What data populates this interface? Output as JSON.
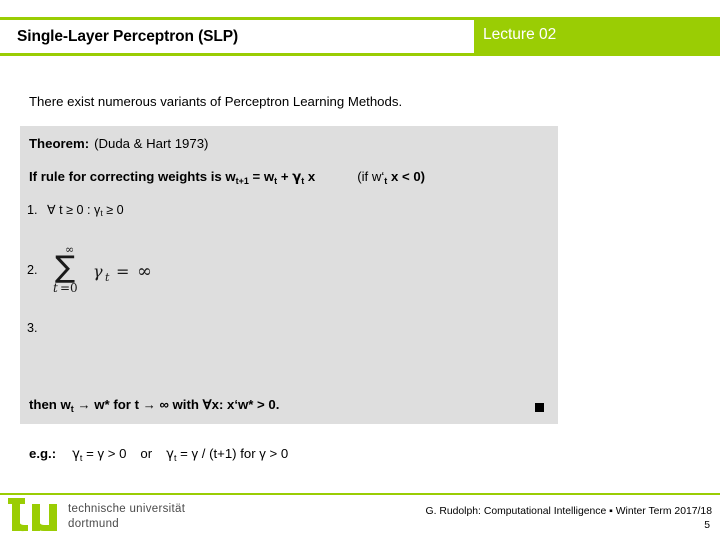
{
  "slide": {
    "header": {
      "title": "Single-Layer Perceptron (SLP)",
      "lecture": "Lecture 02",
      "accent_color": "#9ACD04",
      "plate_color": "#FFFFFF"
    },
    "intro": "There exist numerous variants of Perceptron Learning Methods.",
    "theorem": {
      "background_color": "#DEDEDE",
      "label": "Theorem:",
      "citation": "(Duda & Hart 1973)",
      "rule_text": "If rule for correcting weights is w",
      "rule_sub_1": "t+1",
      "rule_eq": " = w",
      "rule_sub_2": "t",
      "rule_plus": " + ",
      "rule_gamma": "γ",
      "rule_sub_3": "t",
      "rule_x": " x",
      "rule_condition": "(if w‘",
      "rule_condition_sub": "t",
      "rule_condition_tail": " x < 0)",
      "items": [
        {
          "number": "1.",
          "text": "∀ t ≥ 0 : γ",
          "sub": "t",
          "tail": " ≥ 0"
        },
        {
          "number": "2.",
          "formula_alt": "sum from t=0 to infinity of gamma_t = infinity"
        },
        {
          "number": "3.",
          "text": ""
        }
      ],
      "conclusion_pre": "then w",
      "conclusion_sub": "t",
      "conclusion_post": " → w* for t → ∞ with ∀x: x‘w* > 0.",
      "qed_symbol": "■"
    },
    "example": {
      "label": "e.g.:",
      "first_gamma": "γ",
      "first_sub": "t",
      "first_tail": " = γ > 0",
      "conjunction": "or",
      "second_gamma": "γ",
      "second_sub": "t",
      "second_tail": " = γ / (t+1)  for γ > 0"
    },
    "footer": {
      "logo_line1": "technische universität",
      "logo_line2": "dortmund",
      "logo_mark_text": "tu",
      "logo_color": "#9ACD04",
      "credit": "G. Rudolph: Computational Intelligence ▪ Winter Term 2017/18",
      "page_number": "5"
    }
  }
}
